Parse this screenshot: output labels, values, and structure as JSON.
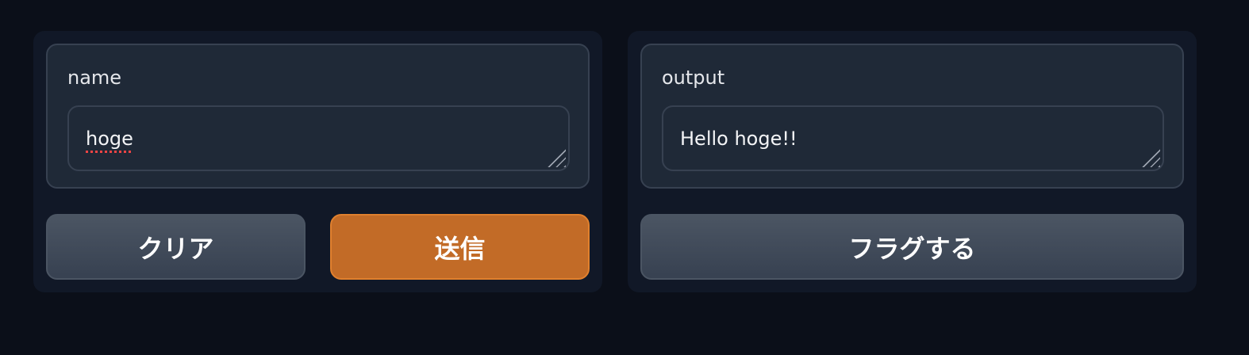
{
  "input_panel": {
    "label": "name",
    "value": "hoge",
    "clear_label": "クリア",
    "submit_label": "送信"
  },
  "output_panel": {
    "label": "output",
    "value": "Hello hoge!!",
    "flag_label": "フラグする"
  },
  "colors": {
    "background": "#0b0f19",
    "panel": "#111827",
    "field": "#1f2937",
    "border": "#374151",
    "primary_button": "#c26b27",
    "secondary_button": "#4b5563"
  },
  "icons": {
    "resize": "resize-handle-icon"
  }
}
